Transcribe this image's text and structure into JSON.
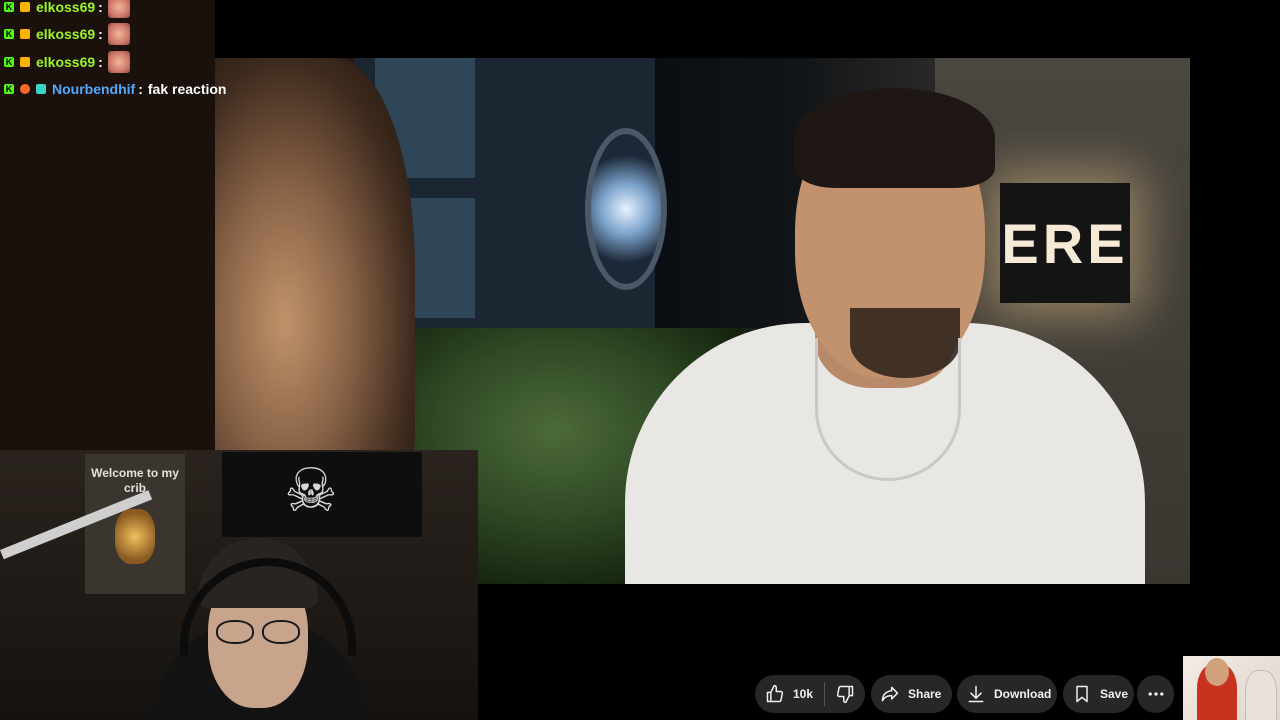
{
  "chat": {
    "messages": [
      {
        "user": "elkoss69",
        "user_color": "#9bf52a",
        "text": "",
        "emote": "emote-face"
      },
      {
        "user": "elkoss69",
        "user_color": "#9bf52a",
        "text": "",
        "emote": "emote-face"
      },
      {
        "user": "elkoss69",
        "user_color": "#9bf52a",
        "text": "",
        "emote": "emote-face"
      },
      {
        "user": "Nourbendhif",
        "user_color": "#54a7ff",
        "text": "fak reaction",
        "emote": ""
      }
    ]
  },
  "video": {
    "sign_text": "ERE"
  },
  "webcam": {
    "poster_text": "Welcome to my crib"
  },
  "actions": {
    "like_count": "10k",
    "share_label": "Share",
    "download_label": "Download",
    "save_label": "Save"
  },
  "colors": {
    "pill_bg": "#272727",
    "kick_green": "#53fc18"
  }
}
